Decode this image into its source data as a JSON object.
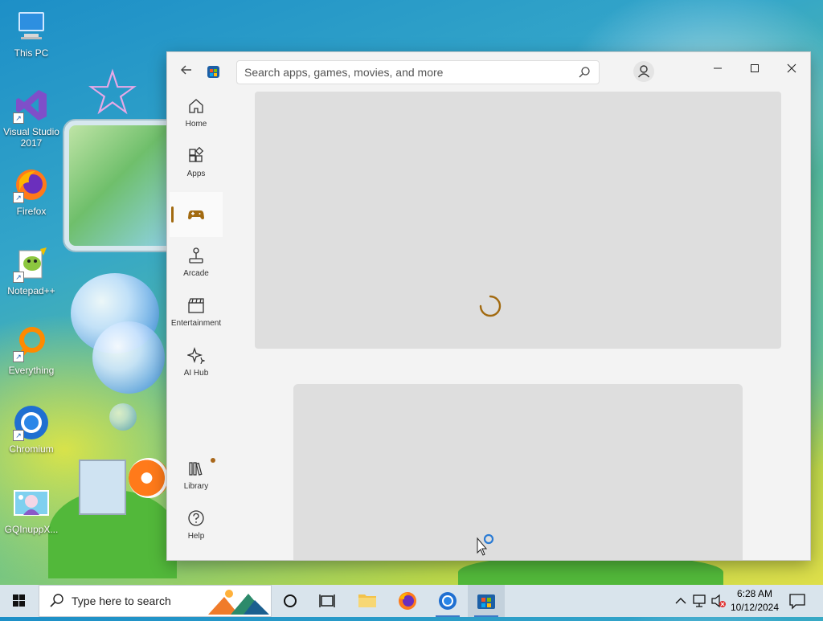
{
  "desktop": {
    "icons": [
      {
        "label": "This PC",
        "icon": "this-pc-icon"
      },
      {
        "label": "Visual Studio 2017",
        "icon": "visual-studio-icon"
      },
      {
        "label": "Firefox",
        "icon": "firefox-icon"
      },
      {
        "label": "Notepad++",
        "icon": "notepad-plus-plus-icon"
      },
      {
        "label": "Everything",
        "icon": "everything-search-icon"
      },
      {
        "label": "Chromium",
        "icon": "chromium-icon"
      },
      {
        "label": "GQInuppX...",
        "icon": "anime-image-file-icon"
      }
    ]
  },
  "store": {
    "search_placeholder": "Search apps, games, movies, and more",
    "nav": [
      {
        "label": "Home",
        "icon": "home-icon",
        "active": false
      },
      {
        "label": "Apps",
        "icon": "apps-icon",
        "active": false
      },
      {
        "label": "",
        "icon": "gamepad-icon",
        "active": true
      },
      {
        "label": "Arcade",
        "icon": "joystick-icon",
        "active": false
      },
      {
        "label": "Entertainment",
        "icon": "clapperboard-icon",
        "active": false
      },
      {
        "label": "AI Hub",
        "icon": "sparkle-icon",
        "active": false
      },
      {
        "label": "Library",
        "icon": "library-icon",
        "active": false,
        "badge": true
      },
      {
        "label": "Help",
        "icon": "help-icon",
        "active": false
      }
    ],
    "accent_color": "#a26a10"
  },
  "taskbar": {
    "search_text": "Type here to search",
    "time": "6:28 AM",
    "date": "10/12/2024"
  }
}
